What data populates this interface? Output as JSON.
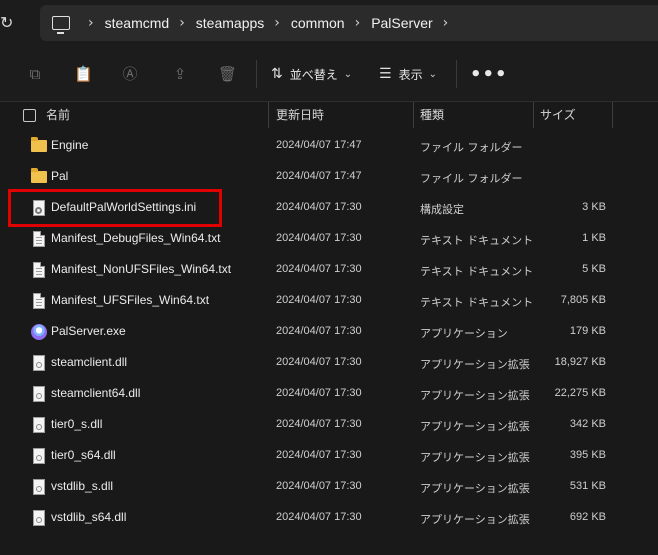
{
  "address": {
    "crumbs": [
      "steamcmd",
      "steamapps",
      "common",
      "PalServer"
    ],
    "pc_icon": "computer-icon",
    "refresh_icon": "refresh-icon"
  },
  "toolbar": {
    "sort_label": "並べ替え",
    "view_label": "表示",
    "more_label": "•••"
  },
  "columns": {
    "name": "名前",
    "date": "更新日時",
    "type": "種類",
    "size": "サイズ"
  },
  "files": [
    {
      "icon": "folder",
      "name": "Engine",
      "date": "2024/04/07 17:47",
      "type": "ファイル フォルダー",
      "size": ""
    },
    {
      "icon": "folder",
      "name": "Pal",
      "date": "2024/04/07 17:47",
      "type": "ファイル フォルダー",
      "size": ""
    },
    {
      "icon": "ini",
      "name": "DefaultPalWorldSettings.ini",
      "date": "2024/04/07 17:30",
      "type": "構成設定",
      "size": "3 KB"
    },
    {
      "icon": "doc",
      "name": "Manifest_DebugFiles_Win64.txt",
      "date": "2024/04/07 17:30",
      "type": "テキスト ドキュメント",
      "size": "1 KB"
    },
    {
      "icon": "doc",
      "name": "Manifest_NonUFSFiles_Win64.txt",
      "date": "2024/04/07 17:30",
      "type": "テキスト ドキュメント",
      "size": "5 KB"
    },
    {
      "icon": "doc",
      "name": "Manifest_UFSFiles_Win64.txt",
      "date": "2024/04/07 17:30",
      "type": "テキスト ドキュメント",
      "size": "7,805 KB"
    },
    {
      "icon": "exe",
      "name": "PalServer.exe",
      "date": "2024/04/07 17:30",
      "type": "アプリケーション",
      "size": "179 KB"
    },
    {
      "icon": "dll",
      "name": "steamclient.dll",
      "date": "2024/04/07 17:30",
      "type": "アプリケーション拡張",
      "size": "18,927 KB"
    },
    {
      "icon": "dll",
      "name": "steamclient64.dll",
      "date": "2024/04/07 17:30",
      "type": "アプリケーション拡張",
      "size": "22,275 KB"
    },
    {
      "icon": "dll",
      "name": "tier0_s.dll",
      "date": "2024/04/07 17:30",
      "type": "アプリケーション拡張",
      "size": "342 KB"
    },
    {
      "icon": "dll",
      "name": "tier0_s64.dll",
      "date": "2024/04/07 17:30",
      "type": "アプリケーション拡張",
      "size": "395 KB"
    },
    {
      "icon": "dll",
      "name": "vstdlib_s.dll",
      "date": "2024/04/07 17:30",
      "type": "アプリケーション拡張",
      "size": "531 KB"
    },
    {
      "icon": "dll",
      "name": "vstdlib_s64.dll",
      "date": "2024/04/07 17:30",
      "type": "アプリケーション拡張",
      "size": "692 KB"
    }
  ],
  "colors": {
    "highlight": "#e00000",
    "folder": "#f1c14d"
  }
}
